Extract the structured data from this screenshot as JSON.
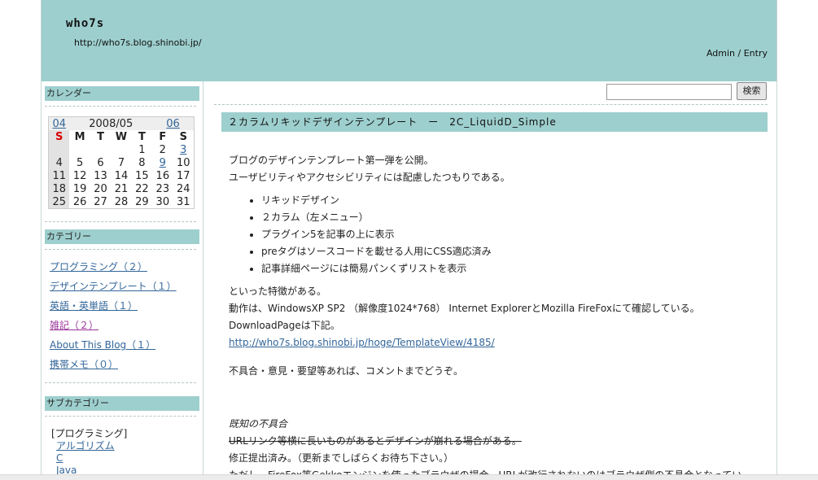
{
  "header": {
    "title": "who7s",
    "url": "http://who7s.blog.shinobi.jp/",
    "admin_label": "Admin",
    "separator": "/",
    "entry_label": "Entry"
  },
  "search": {
    "placeholder": "",
    "button_label": "検索"
  },
  "sidebar": {
    "calendar_heading": "カレンダー",
    "calendar": {
      "prev": "04",
      "month": "2008/05",
      "next": "06",
      "weekdays": [
        "S",
        "M",
        "T",
        "W",
        "T",
        "F",
        "S"
      ],
      "weeks": [
        [
          "",
          "",
          "",
          "",
          "1",
          "2",
          "3"
        ],
        [
          "4",
          "5",
          "6",
          "7",
          "8",
          "9",
          "10"
        ],
        [
          "11",
          "12",
          "13",
          "14",
          "15",
          "16",
          "17"
        ],
        [
          "18",
          "19",
          "20",
          "21",
          "22",
          "23",
          "24"
        ],
        [
          "25",
          "26",
          "27",
          "28",
          "29",
          "30",
          "31"
        ]
      ]
    },
    "category_heading": "カテゴリー",
    "categories": [
      "プログラミング（２）",
      "デザインテンプレート（１）",
      "英語・英単語（１）",
      "雑記（２）",
      "About This Blog（１）",
      "携帯メモ（０）"
    ],
    "subcategory_heading": "サブカテゴリー",
    "subcategory_group": "[プログラミング]",
    "subcategories": [
      "アルゴリズム",
      "C",
      "Java"
    ]
  },
  "entry": {
    "title": "２カラムリキッドデザインテンプレート　ー　2C_LiquidD_Simple",
    "intro1": "ブログのデザインテンプレート第一弾を公開。",
    "intro2": "ユーザビリティやアクセシビリティには配慮したつもりである。",
    "features": [
      "リキッドデザイン",
      "２カラム（左メニュー）",
      "プラグイン5を記事の上に表示",
      "preタグはソースコードを載せる人用にCSS適応済み",
      "記事詳細ページには簡易パンくずリストを表示"
    ],
    "after1": "といった特徴がある。",
    "after2": "動作は、WindowsXP SP2 （解像度1024*768） Internet ExplorerとMozilla FireFoxにて確認している。",
    "after3": "DownloadPageは下記。",
    "link": "http://who7s.blog.shinobi.jp/hoge/TemplateView/4185/",
    "comment": "不具合・意見・要望等あれば、コメントまでどうぞ。",
    "known_issues_heading": "既知の不具合",
    "issue_struck": "URLリンク等横に長いものがあるとデザインが崩れる場合がある。",
    "fix_note": "修正提出済み。（更新までしばらくお待ち下さい。）",
    "last_line": "ただし、FireFox等Gekkoエンジンを使ったブラウザの場合、URLが改行されないのはブラウザ側の不具合となってい"
  }
}
